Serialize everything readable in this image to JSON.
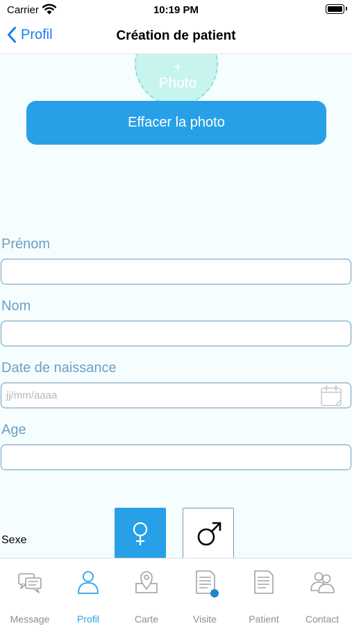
{
  "status_bar": {
    "carrier": "Carrier",
    "time": "10:19 PM"
  },
  "nav": {
    "back_label": "Profil",
    "title": "Création de patient"
  },
  "photo": {
    "plus": "+",
    "label": "Photo",
    "clear_button": "Effacer la photo"
  },
  "form": {
    "first_name_label": "Prénom",
    "last_name_label": "Nom",
    "birth_date_label": "Date de naissance",
    "birth_date_placeholder": "jj/mm/aaaa",
    "age_label": "Age",
    "sex_label": "Sexe"
  },
  "tabs": [
    {
      "label": "Message",
      "icon": "message-icon"
    },
    {
      "label": "Profil",
      "icon": "profile-icon"
    },
    {
      "label": "Carte",
      "icon": "map-icon"
    },
    {
      "label": "Visite",
      "icon": "visit-icon"
    },
    {
      "label": "Patient",
      "icon": "patient-icon"
    },
    {
      "label": "Contact",
      "icon": "contact-icon"
    }
  ],
  "active_tab": "Profil",
  "colors": {
    "accent": "#27a0e7",
    "link": "#1a7cf4",
    "field_border": "#6a9dbb",
    "label": "#6aa1c4",
    "background": "#f6fdff"
  }
}
